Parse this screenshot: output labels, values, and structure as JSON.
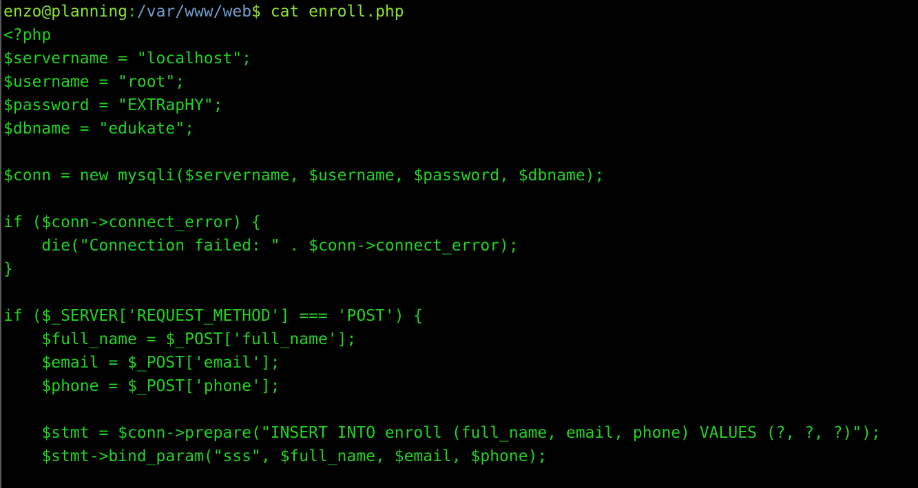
{
  "prompt": {
    "user_host": "enzo@planning",
    "separator": ":",
    "path": "/var/www/web",
    "symbol": "$",
    "command": " cat enroll.php"
  },
  "file_lines": [
    "<?php",
    "$servername = \"localhost\";",
    "$username = \"root\";",
    "$password = \"EXTRapHY\";",
    "$dbname = \"edukate\";",
    "",
    "$conn = new mysqli($servername, $username, $password, $dbname);",
    "",
    "if ($conn->connect_error) {",
    "    die(\"Connection failed: \" . $conn->connect_error);",
    "}",
    "",
    "if ($_SERVER['REQUEST_METHOD'] === 'POST') {",
    "    $full_name = $_POST['full_name'];",
    "    $email = $_POST['email'];",
    "    $phone = $_POST['phone'];",
    "",
    "    $stmt = $conn->prepare(\"INSERT INTO enroll (full_name, email, phone) VALUES (?, ?, ?)\");",
    "    $stmt->bind_param(\"sss\", $full_name, $email, $phone);",
    ""
  ],
  "colors": {
    "background": "#000000",
    "text": "#22d222",
    "prompt_user": "#8ae234",
    "prompt_path": "#729fcf"
  }
}
